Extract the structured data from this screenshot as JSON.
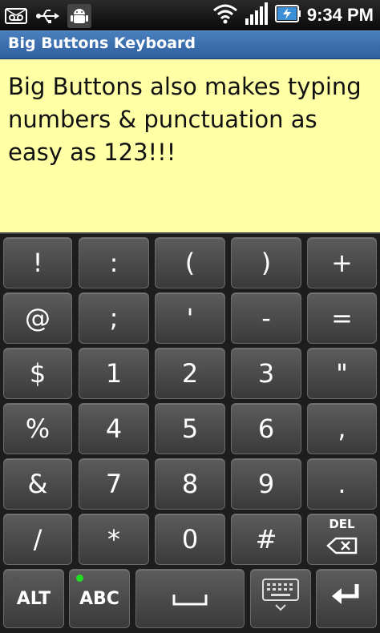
{
  "status_bar": {
    "time": "9:34 PM",
    "icons": [
      "voicemail-icon",
      "usb-icon",
      "android-debug-icon",
      "wifi-icon",
      "signal-icon",
      "battery-charging-icon"
    ]
  },
  "app": {
    "title": "Big Buttons Keyboard"
  },
  "editor": {
    "text": "Big Buttons also makes typing numbers & punctuation as easy as 123!!!"
  },
  "keyboard": {
    "rows": [
      [
        "!",
        ":",
        "(",
        ")",
        "+"
      ],
      [
        "@",
        ";",
        "'",
        "-",
        "="
      ],
      [
        "$",
        "1",
        "2",
        "3",
        "\""
      ],
      [
        "%",
        "4",
        "5",
        "6",
        ","
      ],
      [
        "&",
        "7",
        "8",
        "9",
        "."
      ],
      [
        "/",
        "*",
        "0",
        "#",
        ""
      ]
    ],
    "del_label": "DEL",
    "alt_label": "ALT",
    "abc_label": "ABC",
    "indicator_off_color": "#555555",
    "indicator_on_color": "#22dd22"
  }
}
